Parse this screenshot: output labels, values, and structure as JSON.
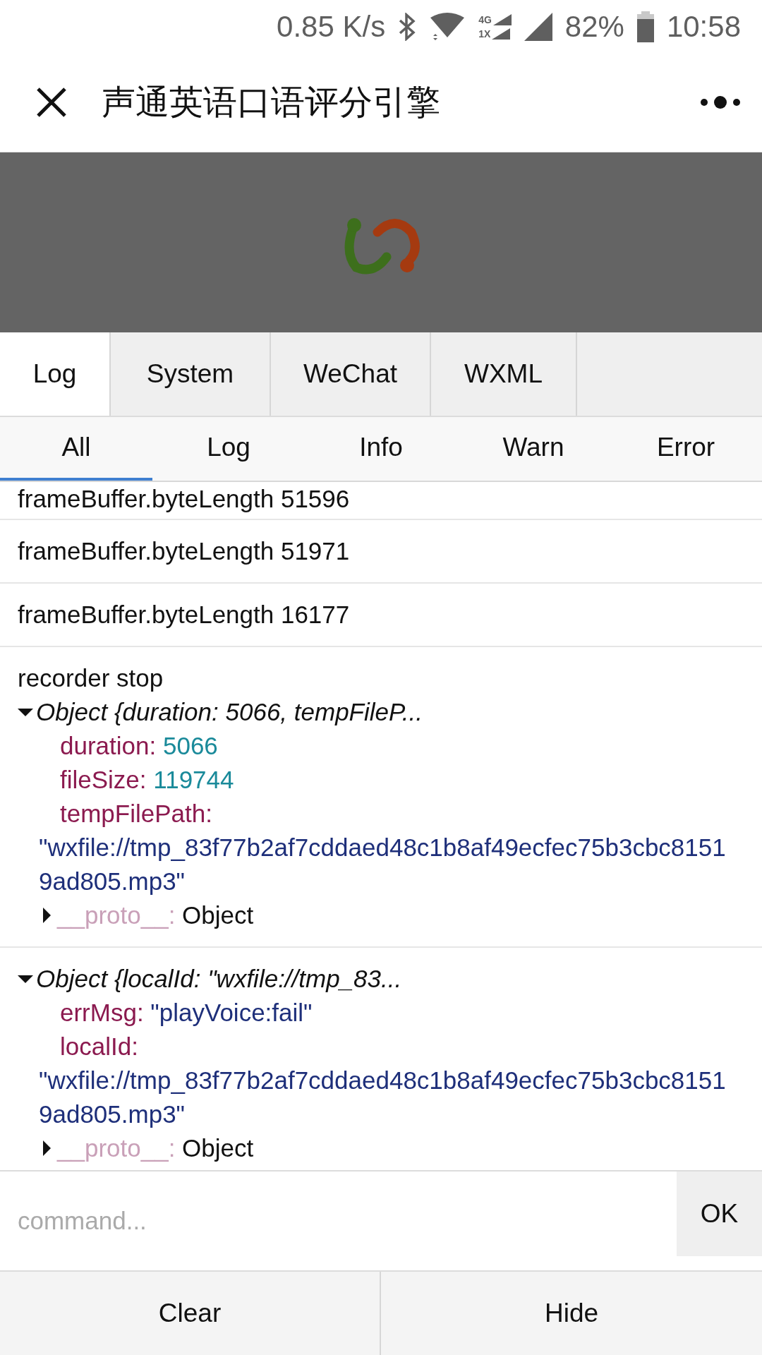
{
  "status_bar": {
    "speed": "0.85 K/s",
    "network_labels": [
      "4G",
      "1X"
    ],
    "battery": "82%",
    "time": "10:58"
  },
  "header": {
    "title": "声通英语口语评分引擎"
  },
  "tabs": [
    {
      "label": "Log",
      "selected": true
    },
    {
      "label": "System",
      "selected": false
    },
    {
      "label": "WeChat",
      "selected": false
    },
    {
      "label": "WXML",
      "selected": false
    }
  ],
  "filters": [
    {
      "label": "All",
      "selected": true
    },
    {
      "label": "Log",
      "selected": false
    },
    {
      "label": "Info",
      "selected": false
    },
    {
      "label": "Warn",
      "selected": false
    },
    {
      "label": "Error",
      "selected": false
    }
  ],
  "logs": [
    {
      "lines": [
        {
          "kind": "text",
          "text": "frameBuffer.byteLength 51596"
        }
      ]
    },
    {
      "lines": [
        {
          "kind": "text",
          "text": "frameBuffer.byteLength 51971"
        }
      ]
    },
    {
      "lines": [
        {
          "kind": "text",
          "text": "frameBuffer.byteLength 16177"
        }
      ]
    },
    {
      "lines": [
        {
          "kind": "text",
          "text": "recorder stop"
        },
        {
          "kind": "object",
          "expanded": true,
          "summary": "Object {duration: 5066, tempFileP...",
          "properties": [
            {
              "key": "duration:",
              "value": "5066",
              "kind": "number"
            },
            {
              "key": "fileSize:",
              "value": "119744",
              "kind": "number"
            },
            {
              "key": "tempFilePath:",
              "value": "\"wxfile://tmp_83f77b2af7cddaed48c1b8af49ecfec75b3cbc81519ad805.mp3\"",
              "kind": "string"
            }
          ],
          "proto": {
            "key": "__proto__:",
            "value": "Object",
            "expanded": false
          }
        }
      ]
    },
    {
      "lines": [
        {
          "kind": "object",
          "expanded": true,
          "summary": "Object {localId: \"wxfile://tmp_83...",
          "properties": [
            {
              "key": "errMsg:",
              "value": "\"playVoice:fail\"",
              "kind": "string"
            },
            {
              "key": "localId:",
              "value": "\"wxfile://tmp_83f77b2af7cddaed48c1b8af49ecfec75b3cbc81519ad805.mp3\"",
              "kind": "string"
            }
          ],
          "proto": {
            "key": "__proto__:",
            "value": "Object",
            "expanded": false
          }
        }
      ]
    }
  ],
  "command": {
    "placeholder": "command...",
    "button": "OK"
  },
  "footer_buttons": [
    "Clear",
    "Hide"
  ]
}
